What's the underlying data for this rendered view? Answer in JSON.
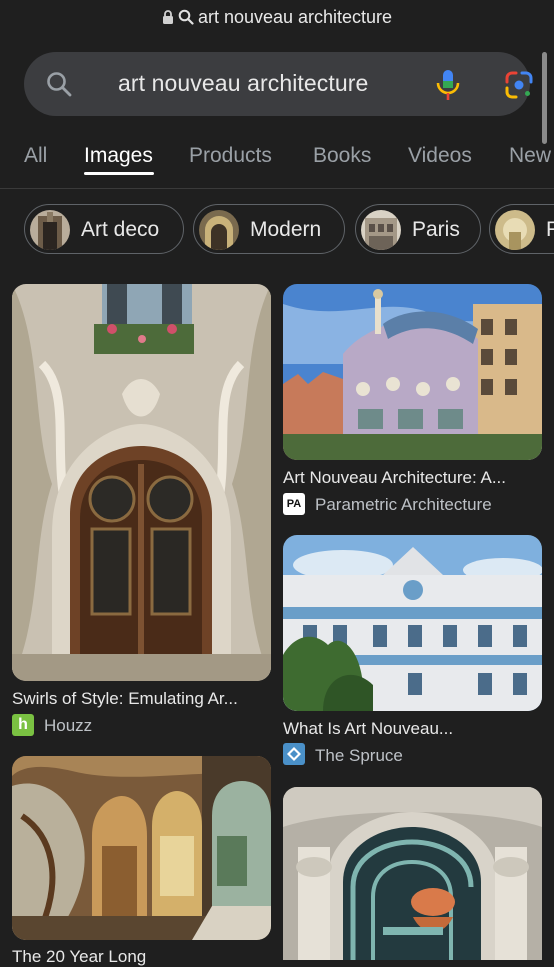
{
  "browser": {
    "url_text": "art nouveau architecture"
  },
  "search": {
    "query": "art nouveau architecture"
  },
  "tabs": [
    {
      "label": "All"
    },
    {
      "label": "Images"
    },
    {
      "label": "Products"
    },
    {
      "label": "Books"
    },
    {
      "label": "Videos"
    },
    {
      "label": "New"
    }
  ],
  "active_tab": "Images",
  "chips": [
    {
      "label": "Art deco"
    },
    {
      "label": "Modern"
    },
    {
      "label": "Paris"
    },
    {
      "label": "F"
    }
  ],
  "results": [
    {
      "caption": "Swirls of Style: Emulating Ar...",
      "source": "Houzz",
      "favicon_text": "h",
      "favicon_color": "#7ac142"
    },
    {
      "caption": "Art Nouveau Architecture: A...",
      "source": "Parametric Architecture",
      "favicon_text": "PA",
      "favicon_color": "#ffffff"
    },
    {
      "caption": "What Is Art Nouveau...",
      "source": "The Spruce",
      "favicon_text": "",
      "favicon_color": "#4a90c8"
    },
    {
      "caption": "The 20 Year Long",
      "source": "",
      "favicon_text": "",
      "favicon_color": ""
    }
  ],
  "colors": {
    "background": "#1f1f1f",
    "search_box": "#3c3d40",
    "chip_border": "#5f6368"
  }
}
